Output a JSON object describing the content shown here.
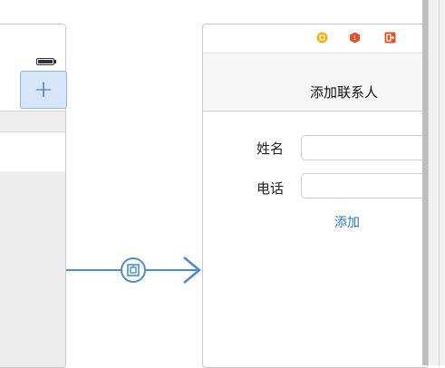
{
  "left_scene": {
    "add_button": {
      "label": "+",
      "icon": "plus-icon"
    }
  },
  "segue": {
    "icon": "segue-show-icon",
    "color": "#4a8fd0"
  },
  "right_scene": {
    "dock": {
      "icons": [
        "view-controller-icon",
        "first-responder-icon",
        "exit-icon"
      ],
      "colors": {
        "view_controller": "#f2b21a",
        "first_responder": "#e0542a",
        "exit": "#e0542a"
      }
    },
    "nav_title": "添加联系人",
    "name_label": "姓名",
    "phone_label": "电话",
    "name_field_value": "",
    "phone_field_value": "",
    "add_button_label": "添加"
  },
  "colors": {
    "accent": "#2f73c8",
    "selection_fill": "#d6e6f8"
  }
}
